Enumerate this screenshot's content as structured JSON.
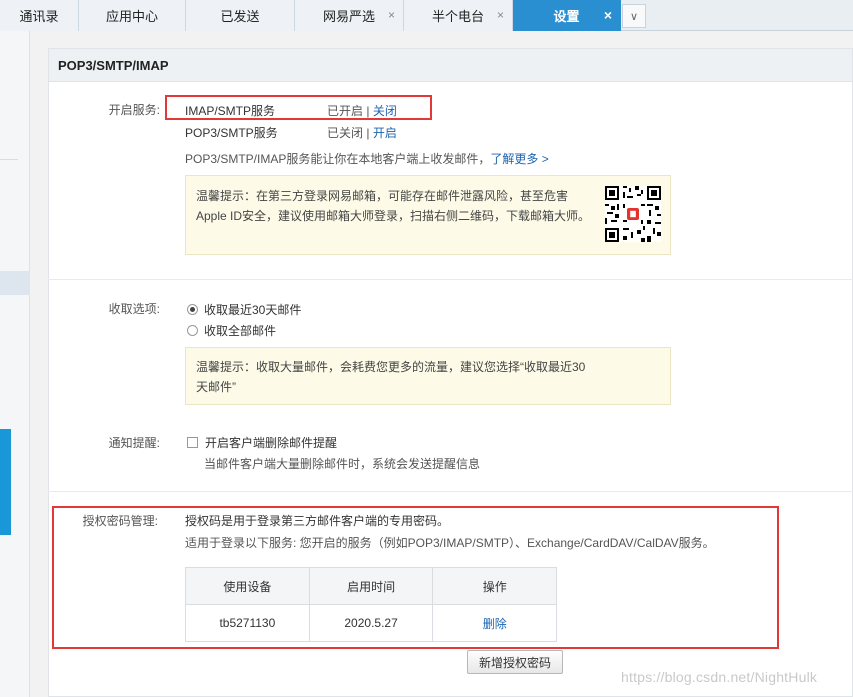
{
  "tabs": [
    {
      "label": "通讯录",
      "closable": false,
      "active": false
    },
    {
      "label": "应用中心",
      "closable": false,
      "active": false
    },
    {
      "label": "已发送",
      "closable": false,
      "active": false
    },
    {
      "label": "网易严选",
      "closable": true,
      "active": false
    },
    {
      "label": "半个电台",
      "closable": true,
      "active": false
    },
    {
      "label": "设置",
      "closable": true,
      "active": true
    }
  ],
  "tab_close_glyph": "×",
  "tab_more_glyph": "∨",
  "panel_title": "POP3/SMTP/IMAP",
  "services": {
    "label": "开启服务:",
    "items": [
      {
        "name": "IMAP/SMTP服务",
        "status": "已开启",
        "separator": "|",
        "action": "关闭"
      },
      {
        "name": "POP3/SMTP服务",
        "status": "已关闭",
        "separator": "|",
        "action": "开启"
      }
    ],
    "description": "POP3/SMTP/IMAP服务能让你在本地客户端上收发邮件，",
    "learn_more": "了解更多 >",
    "tip_line1": "温馨提示：在第三方登录网易邮箱，可能存在邮件泄露风险，甚至危害",
    "tip_line2": "Apple ID安全，建议使用邮箱大师登录，扫描右侧二维码，下载邮箱大师。"
  },
  "receive_options": {
    "label": "收取选项:",
    "options": [
      {
        "label": "收取最近30天邮件",
        "checked": true
      },
      {
        "label": "收取全部邮件",
        "checked": false
      }
    ],
    "tip_line1": "温馨提示：收取大量邮件，会耗费您更多的流量，建议您选择“收取最近30",
    "tip_line2": "天邮件”"
  },
  "notify": {
    "label": "通知提醒:",
    "checkbox_label": "开启客户端删除邮件提醒",
    "checked": false,
    "sub_text": "当邮件客户端大量删除邮件时，系统会发送提醒信息"
  },
  "auth_codes": {
    "label": "授权密码管理:",
    "line1": "授权码是用于登录第三方邮件客户端的专用密码。",
    "line2": "适用于登录以下服务: 您开启的服务（例如POP3/IMAP/SMTP）、Exchange/CardDAV/CalDAV服务。",
    "columns": [
      "使用设备",
      "启用时间",
      "操作"
    ],
    "rows": [
      {
        "device": "tb5271130",
        "date": "2020.5.27",
        "action": "删除"
      }
    ],
    "add_button": "新增授权密码"
  },
  "watermark": "https://blog.csdn.net/NightHulk",
  "colors": {
    "active_tab": "#2a8fd1",
    "link": "#1d64b0",
    "highlight_box": "#e23838",
    "tip_background": "#fdfbe8"
  }
}
